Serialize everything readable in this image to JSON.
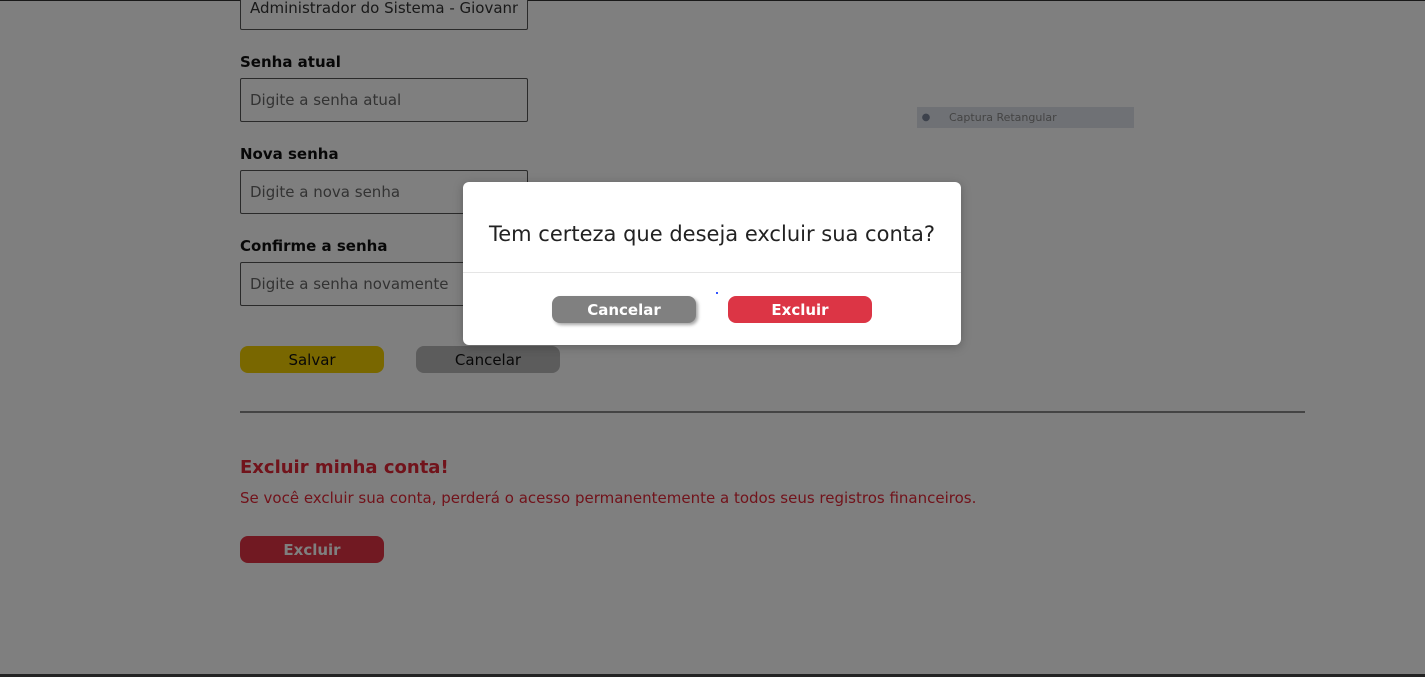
{
  "form": {
    "user_value": "Administrador do Sistema - Giovanny",
    "current_password": {
      "label": "Senha atual",
      "placeholder": "Digite a senha atual"
    },
    "new_password": {
      "label": "Nova senha",
      "placeholder": "Digite a nova senha"
    },
    "confirm_password": {
      "label": "Confirme a senha",
      "placeholder": "Digite a senha novamente"
    },
    "save_label": "Salvar",
    "cancel_label": "Cancelar"
  },
  "danger_zone": {
    "title": "Excluir minha conta!",
    "description": "Se você excluir sua conta, perderá o acesso permanentemente a todos seus registros financeiros.",
    "delete_label": "Excluir"
  },
  "snip_toolbar": {
    "label": "Captura Retangular",
    "icon": "capture-icon"
  },
  "modal": {
    "question": "Tem certeza que deseja excluir sua conta?",
    "cancel_label": "Cancelar",
    "confirm_label": "Excluir"
  },
  "colors": {
    "save": "#f2cf00",
    "cancel": "#808080",
    "danger": "#dc3545",
    "danger_text": "#e32636"
  }
}
